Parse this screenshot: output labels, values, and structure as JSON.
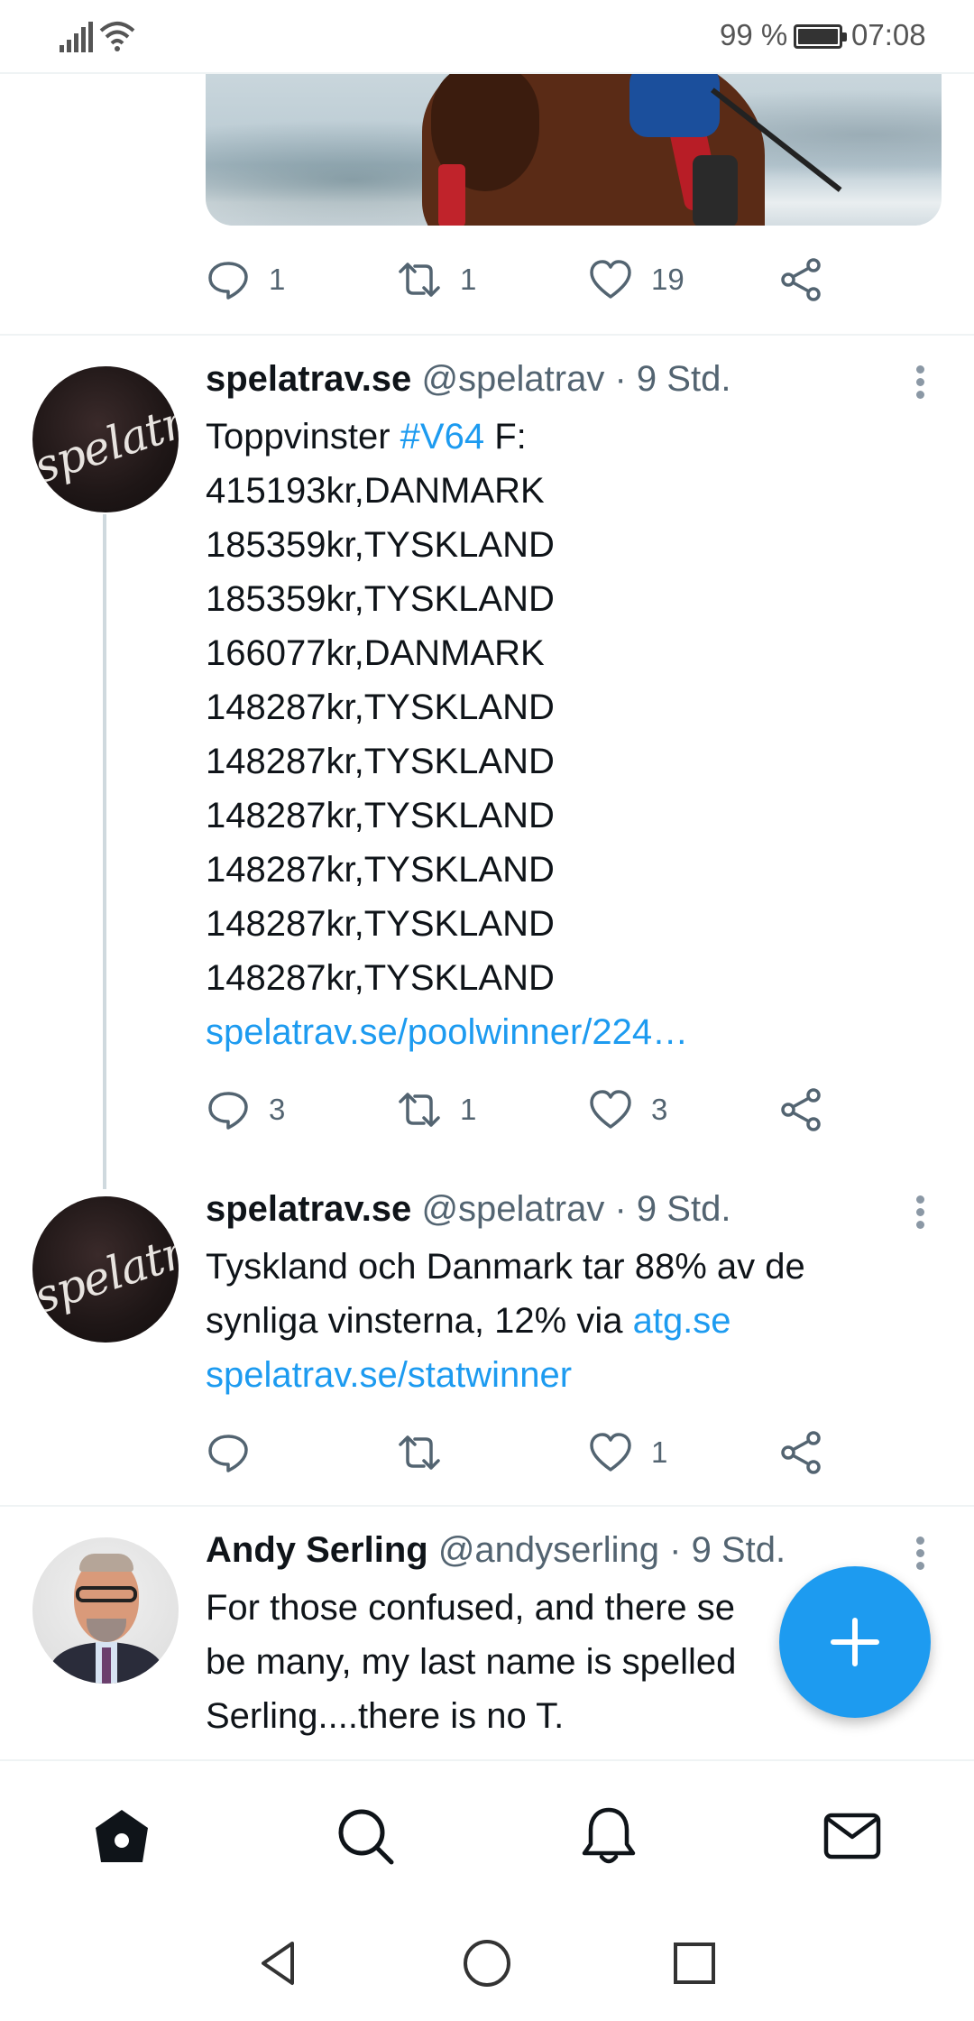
{
  "status_bar": {
    "battery_percent": "99 %",
    "time": "07:08"
  },
  "top_tweet_actions": {
    "replies": "1",
    "retweets": "1",
    "likes": "19"
  },
  "tweets": [
    {
      "name": "spelatrav.se",
      "handle": "@spelatrav",
      "time": "· 9 Std.",
      "avatar_text": "spelatrav.",
      "body_intro": "Toppvinster ",
      "hashtag": "#V64",
      "body_intro_suffix": " F:",
      "lines": [
        "415193kr,DANMARK",
        "185359kr,TYSKLAND",
        "185359kr,TYSKLAND",
        "166077kr,DANMARK",
        "148287kr,TYSKLAND",
        "148287kr,TYSKLAND",
        "148287kr,TYSKLAND",
        "148287kr,TYSKLAND",
        "148287kr,TYSKLAND",
        "148287kr,TYSKLAND"
      ],
      "link": "spelatrav.se/poolwinner/224…",
      "replies": "3",
      "retweets": "1",
      "likes": "3"
    },
    {
      "name": "spelatrav.se",
      "handle": "@spelatrav",
      "time": "· 9 Std.",
      "avatar_text": "spelatrav.",
      "line1": "Tyskland och Danmark tar 88% av de",
      "line2_text": "synliga vinsterna, 12% via ",
      "line2_link": "atg.se",
      "line3_link": "spelatrav.se/statwinner",
      "replies": "",
      "retweets": "",
      "likes": "1"
    },
    {
      "name": "Andy Serling",
      "handle": "@andyserling",
      "time": "· 9 Std.",
      "line1": "For those confused, and there se",
      "line2": "be many, my last name is spelled",
      "line3": "Serling....there is no T."
    }
  ],
  "icons": {
    "reply": "speech-bubble-icon",
    "retweet": "retweet-icon",
    "like": "heart-icon",
    "share": "share-icon",
    "compose": "plus-icon",
    "nav": [
      "home-icon",
      "search-icon",
      "bell-icon",
      "mail-icon"
    ],
    "system": [
      "back-triangle-icon",
      "home-circle-icon",
      "recents-square-icon"
    ]
  },
  "colors": {
    "link": "#1d9bf0",
    "muted": "#536471",
    "fab": "#1d9bf0"
  }
}
